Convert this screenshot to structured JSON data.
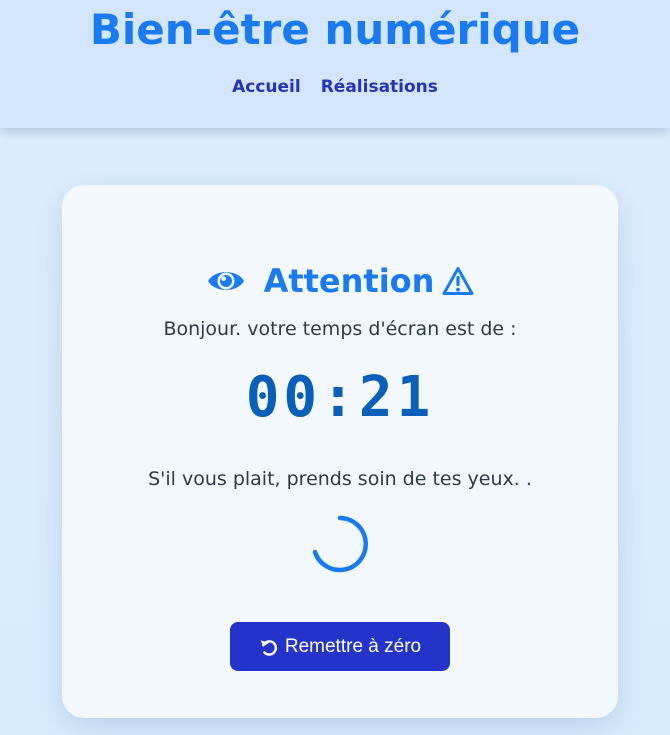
{
  "header": {
    "title": "Bien-être numérique",
    "nav": [
      {
        "label": "Accueil"
      },
      {
        "label": "Réalisations"
      }
    ]
  },
  "card": {
    "heading": "Attention",
    "greeting": "Bonjour. votre temps d'écran est de :",
    "timer": "00:21",
    "care_message": "S'il vous plait, prends soin de tes yeux. .",
    "reset_label": "Remettre à zéro"
  },
  "icons": {
    "heading_left": "eye-icon",
    "heading_right": "warning-icon",
    "loader": "spinner-icon",
    "reset": "rotate-ccw-icon"
  },
  "colors": {
    "brand": "#1a7af0",
    "nav_text": "#2433b8",
    "timer": "#0a5fb8",
    "button": "#2433c9",
    "header_bg": "#d4e6fd",
    "card_bg": "#f2f8fe"
  }
}
